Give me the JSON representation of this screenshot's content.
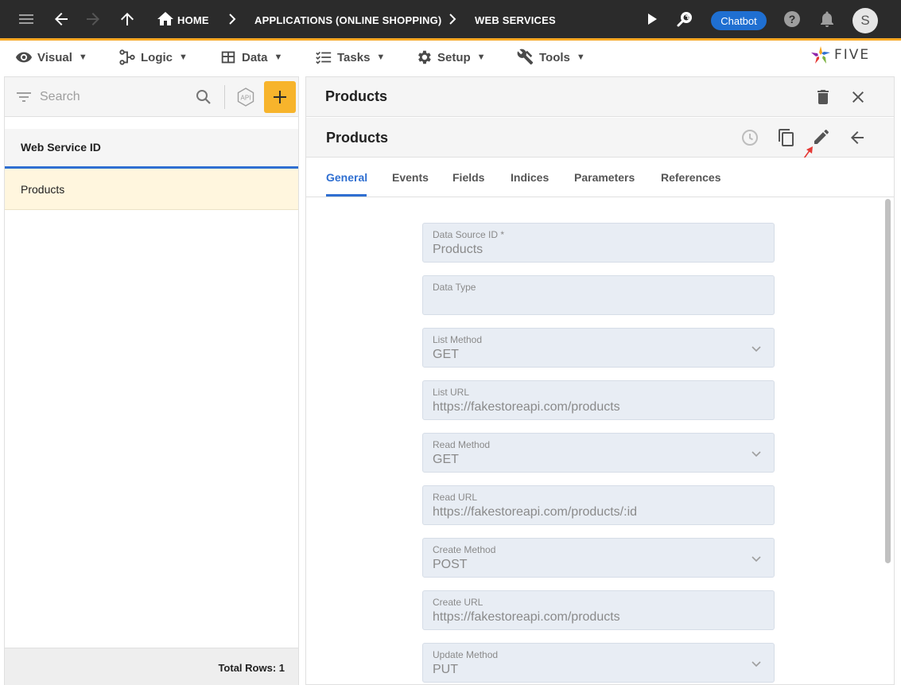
{
  "topbar": {
    "breadcrumbs": [
      "HOME",
      "APPLICATIONS (ONLINE SHOPPING)",
      "WEB SERVICES"
    ],
    "chatbot_label": "Chatbot",
    "avatar_initial": "S",
    "accent_color": "#f7a823"
  },
  "menu": {
    "items": [
      {
        "label": "Visual",
        "icon": "eye-icon"
      },
      {
        "label": "Logic",
        "icon": "logic-icon"
      },
      {
        "label": "Data",
        "icon": "table-icon"
      },
      {
        "label": "Tasks",
        "icon": "tasks-icon"
      },
      {
        "label": "Setup",
        "icon": "gear-icon"
      },
      {
        "label": "Tools",
        "icon": "tools-icon"
      }
    ],
    "caret": "▼",
    "logo_text": "FIVE"
  },
  "left_panel": {
    "search_placeholder": "Search",
    "api_badge": "API",
    "column_header": "Web Service ID",
    "rows": [
      "Products"
    ],
    "footer": "Total Rows: 1"
  },
  "right_panel": {
    "title": "Products",
    "form_title": "Products",
    "tabs": [
      "General",
      "Events",
      "Fields",
      "Indices",
      "Parameters",
      "References"
    ],
    "active_tab": "General",
    "fields": [
      {
        "label": "Data Source ID *",
        "value": "Products",
        "dropdown": false
      },
      {
        "label": "Data Type",
        "value": "",
        "dropdown": false
      },
      {
        "label": "List Method",
        "value": "GET",
        "dropdown": true
      },
      {
        "label": "List URL",
        "value": "https://fakestoreapi.com/products",
        "dropdown": false
      },
      {
        "label": "Read Method",
        "value": "GET",
        "dropdown": true
      },
      {
        "label": "Read URL",
        "value": "https://fakestoreapi.com/products/:id",
        "dropdown": false
      },
      {
        "label": "Create Method",
        "value": "POST",
        "dropdown": true
      },
      {
        "label": "Create URL",
        "value": "https://fakestoreapi.com/products",
        "dropdown": false
      },
      {
        "label": "Update Method",
        "value": "PUT",
        "dropdown": true
      }
    ]
  }
}
